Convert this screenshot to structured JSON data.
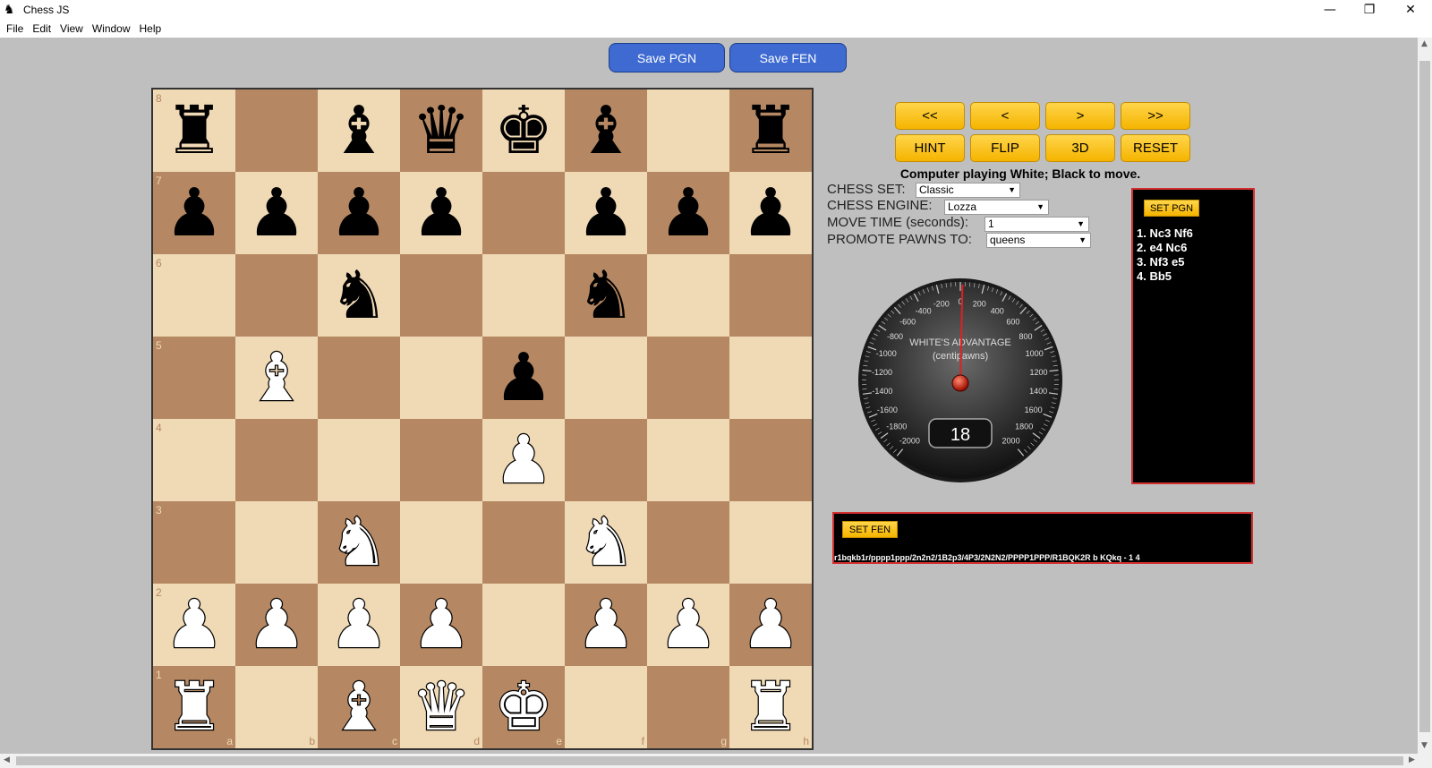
{
  "window": {
    "title": "Chess JS",
    "app_icon": "♞",
    "minimize": "—",
    "maximize": "❐",
    "close": "✕"
  },
  "menu": [
    "File",
    "Edit",
    "View",
    "Window",
    "Help"
  ],
  "toolbar": {
    "save_pgn": "Save PGN",
    "save_fen": "Save FEN"
  },
  "board": {
    "rows": [
      [
        "r",
        "",
        "b",
        "q",
        "k",
        "b",
        "",
        "r"
      ],
      [
        "p",
        "p",
        "p",
        "p",
        "",
        "p",
        "p",
        "p"
      ],
      [
        "",
        "",
        "n",
        "",
        "",
        "n",
        "",
        ""
      ],
      [
        "",
        "B",
        "",
        "",
        "p",
        "",
        "",
        ""
      ],
      [
        "",
        "",
        "",
        "",
        "P",
        "",
        "",
        ""
      ],
      [
        "",
        "",
        "N",
        "",
        "",
        "N",
        "",
        ""
      ],
      [
        "P",
        "P",
        "P",
        "P",
        "",
        "P",
        "P",
        "P"
      ],
      [
        "R",
        "",
        "B",
        "Q",
        "K",
        "",
        "",
        "R"
      ]
    ],
    "ranks": [
      "8",
      "7",
      "6",
      "5",
      "4",
      "3",
      "2",
      "1"
    ],
    "files": [
      "a",
      "b",
      "c",
      "d",
      "e",
      "f",
      "g",
      "h"
    ],
    "colors": {
      "light": "#f0d9b5",
      "dark": "#b58863"
    }
  },
  "controls": {
    "first": "<<",
    "prev": "<",
    "next": ">",
    "last": ">>",
    "hint": "HINT",
    "flip": "FLIP",
    "three_d": "3D",
    "reset": "RESET"
  },
  "status": "Computer playing White; Black to move.",
  "options": {
    "chess_set": {
      "label": "CHESS SET:",
      "value": "Classic"
    },
    "chess_engine": {
      "label": "CHESS ENGINE:",
      "value": "Lozza"
    },
    "move_time": {
      "label": "MOVE TIME (seconds):",
      "value": "1"
    },
    "promote": {
      "label": "PROMOTE PAWNS TO:",
      "value": "queens"
    }
  },
  "gauge": {
    "title": "WHITE'S ADVANTAGE",
    "subtitle": "(centipawns)",
    "value": "18",
    "range": [
      -2000,
      2000
    ],
    "left_ticks": [
      "-200",
      "-400",
      "-600",
      "-800",
      "-1000",
      "-1200",
      "-1400",
      "-1600",
      "-1800",
      "-2000"
    ],
    "right_ticks": [
      "200",
      "400",
      "600",
      "800",
      "1000",
      "1200",
      "1400",
      "1600",
      "1800",
      "2000"
    ],
    "zero": "0"
  },
  "pgn": {
    "button": "SET PGN",
    "moves": [
      "1. Nc3 Nf6",
      "2. e4 Nc6",
      "3. Nf3 e5",
      "4. Bb5"
    ]
  },
  "fen": {
    "button": "SET FEN",
    "value": "r1bqkb1r/pppp1ppp/2n2n2/1B2p3/4P3/2N2N2/PPPP1PPP/R1BQK2R b KQkq - 1 4"
  },
  "colors": {
    "accent_blue": "#3e6ad1",
    "button_gold": "#f5b400",
    "panel_border": "#d32f2f"
  }
}
